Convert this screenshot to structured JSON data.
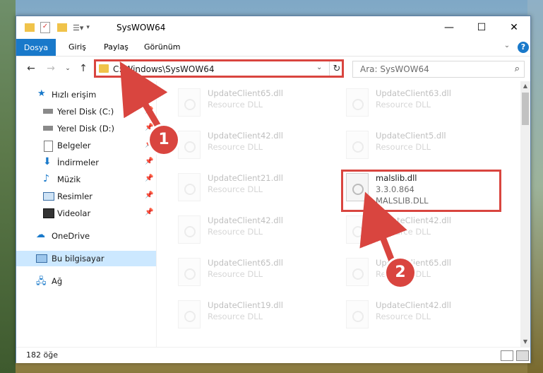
{
  "window": {
    "title": "SysWOW64",
    "controls": {
      "minimize": "—",
      "maximize": "☐",
      "close": "✕"
    }
  },
  "ribbon": {
    "file_tab": "Dosya",
    "tabs": [
      "Giriş",
      "Paylaş",
      "Görünüm"
    ],
    "help": "?"
  },
  "nav": {
    "address": "C:\\Windows\\SysWOW64",
    "search_placeholder": "Ara: SysWOW64"
  },
  "sidebar": {
    "items": [
      {
        "label": "Hızlı erişim",
        "icon": "star-icon"
      },
      {
        "label": "Yerel Disk (C:)",
        "icon": "drive-icon",
        "pinned": true
      },
      {
        "label": "Yerel Disk (D:)",
        "icon": "drive-icon",
        "pinned": true
      },
      {
        "label": "Belgeler",
        "icon": "document-icon",
        "pinned": true
      },
      {
        "label": "İndirmeler",
        "icon": "download-icon",
        "pinned": true
      },
      {
        "label": "Müzik",
        "icon": "music-icon",
        "pinned": true
      },
      {
        "label": "Resimler",
        "icon": "picture-icon",
        "pinned": true
      },
      {
        "label": "Videolar",
        "icon": "video-icon",
        "pinned": true
      },
      {
        "label": "OneDrive",
        "icon": "cloud-icon"
      },
      {
        "label": "Bu bilgisayar",
        "icon": "computer-icon",
        "selected": true
      },
      {
        "label": "Ağ",
        "icon": "network-icon"
      }
    ]
  },
  "files": [
    {
      "name": "UpdateClient65.dll",
      "type": "Resource DLL"
    },
    {
      "name": "UpdateClient63.dll",
      "type": "Resource DLL"
    },
    {
      "name": "UpdateClient42.dll",
      "type": "Resource DLL"
    },
    {
      "name": "UpdateClient5.dll",
      "type": "Resource DLL"
    },
    {
      "name": "UpdateClient21.dll",
      "type": "Resource DLL"
    },
    {
      "name": "malslib.dll",
      "version": "3.3.0.864",
      "desc": "MALSLIB.DLL"
    },
    {
      "name": "UpdateClient42.dll",
      "type": "Resource DLL"
    },
    {
      "name": "UpdateClient42.dll",
      "type": "Resource DLL"
    },
    {
      "name": "UpdateClient65.dll",
      "type": "Resource DLL"
    },
    {
      "name": "UpdateClient65.dll",
      "type": "Resource DLL"
    },
    {
      "name": "UpdateClient19.dll",
      "type": "Resource DLL"
    },
    {
      "name": "UpdateClient42.dll",
      "type": "Resource DLL"
    }
  ],
  "status": {
    "count": "182 öğe"
  },
  "annotations": {
    "step1": "1",
    "step2": "2",
    "color": "#d9453f"
  }
}
